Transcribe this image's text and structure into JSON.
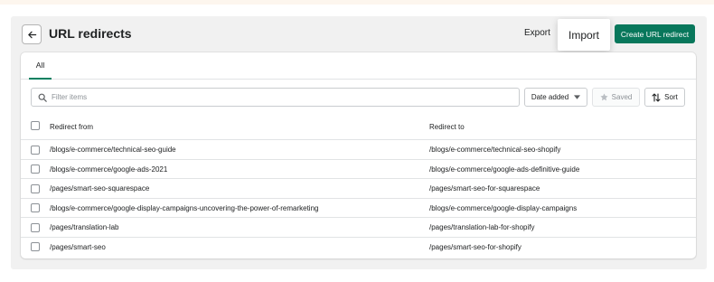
{
  "header": {
    "title": "URL redirects",
    "export_label": "Export",
    "import_label": "Import",
    "create_label": "Create URL redirect"
  },
  "tabs": [
    {
      "label": "All"
    }
  ],
  "filters": {
    "search_placeholder": "Filter items",
    "date_label": "Date added",
    "saved_label": "Saved",
    "sort_label": "Sort"
  },
  "table": {
    "columns": {
      "from": "Redirect from",
      "to": "Redirect to"
    },
    "rows": [
      {
        "from": "/blogs/e-commerce/technical-seo-guide",
        "to": "/blogs/e-commerce/technical-seo-shopify"
      },
      {
        "from": "/blogs/e-commerce/google-ads-2021",
        "to": "/blogs/e-commerce/google-ads-definitive-guide"
      },
      {
        "from": "/pages/smart-seo-squarespace",
        "to": "/pages/smart-seo-for-squarespace"
      },
      {
        "from": "/blogs/e-commerce/google-display-campaigns-uncovering-the-power-of-remarketing",
        "to": "/blogs/e-commerce/google-display-campaigns"
      },
      {
        "from": "/pages/translation-lab",
        "to": "/pages/translation-lab-for-shopify"
      },
      {
        "from": "/pages/smart-seo",
        "to": "/pages/smart-seo-for-shopify"
      }
    ]
  },
  "colors": {
    "primary": "#08775b",
    "tab_underline": "#008060",
    "page_bg": "#f1f1f1"
  },
  "icons": [
    "arrow-left-icon",
    "search-icon",
    "caret-down-icon",
    "star-icon",
    "sort-icon"
  ]
}
